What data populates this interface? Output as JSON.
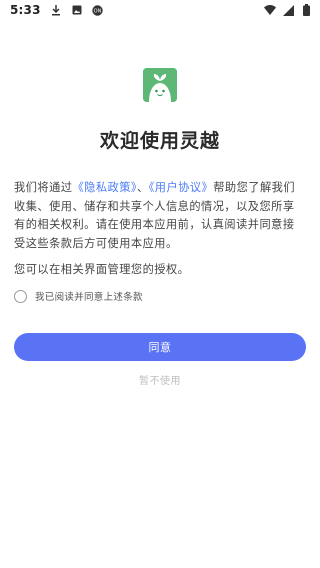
{
  "status_bar": {
    "time": "5:33",
    "icons": [
      "download-icon",
      "image-icon",
      "notification-badge-icon",
      "wifi-icon",
      "signal-icon",
      "battery-icon"
    ]
  },
  "app": {
    "logo_icon": "sprout-face-icon",
    "brand_color": "#5cb874"
  },
  "title": "欢迎使用灵越",
  "agreement": {
    "intro": "我们将通过",
    "privacy_link": "《隐私政策》",
    "separator": "、",
    "user_agreement_link": "《用户协议》",
    "body": "帮助您了解我们收集、使用、储存和共享个人信息的情况，以及您所享有的相关权利。请在使用本应用前，认真阅读并同意接受这些条款后方可使用本应用。",
    "note": "您可以在相关界面管理您的授权。",
    "checkbox_label": "我已阅读并同意上述条款"
  },
  "actions": {
    "agree_label": "同意",
    "decline_label": "暂不使用",
    "accent_color": "#5a73f5",
    "link_color": "#4a7bf7"
  }
}
